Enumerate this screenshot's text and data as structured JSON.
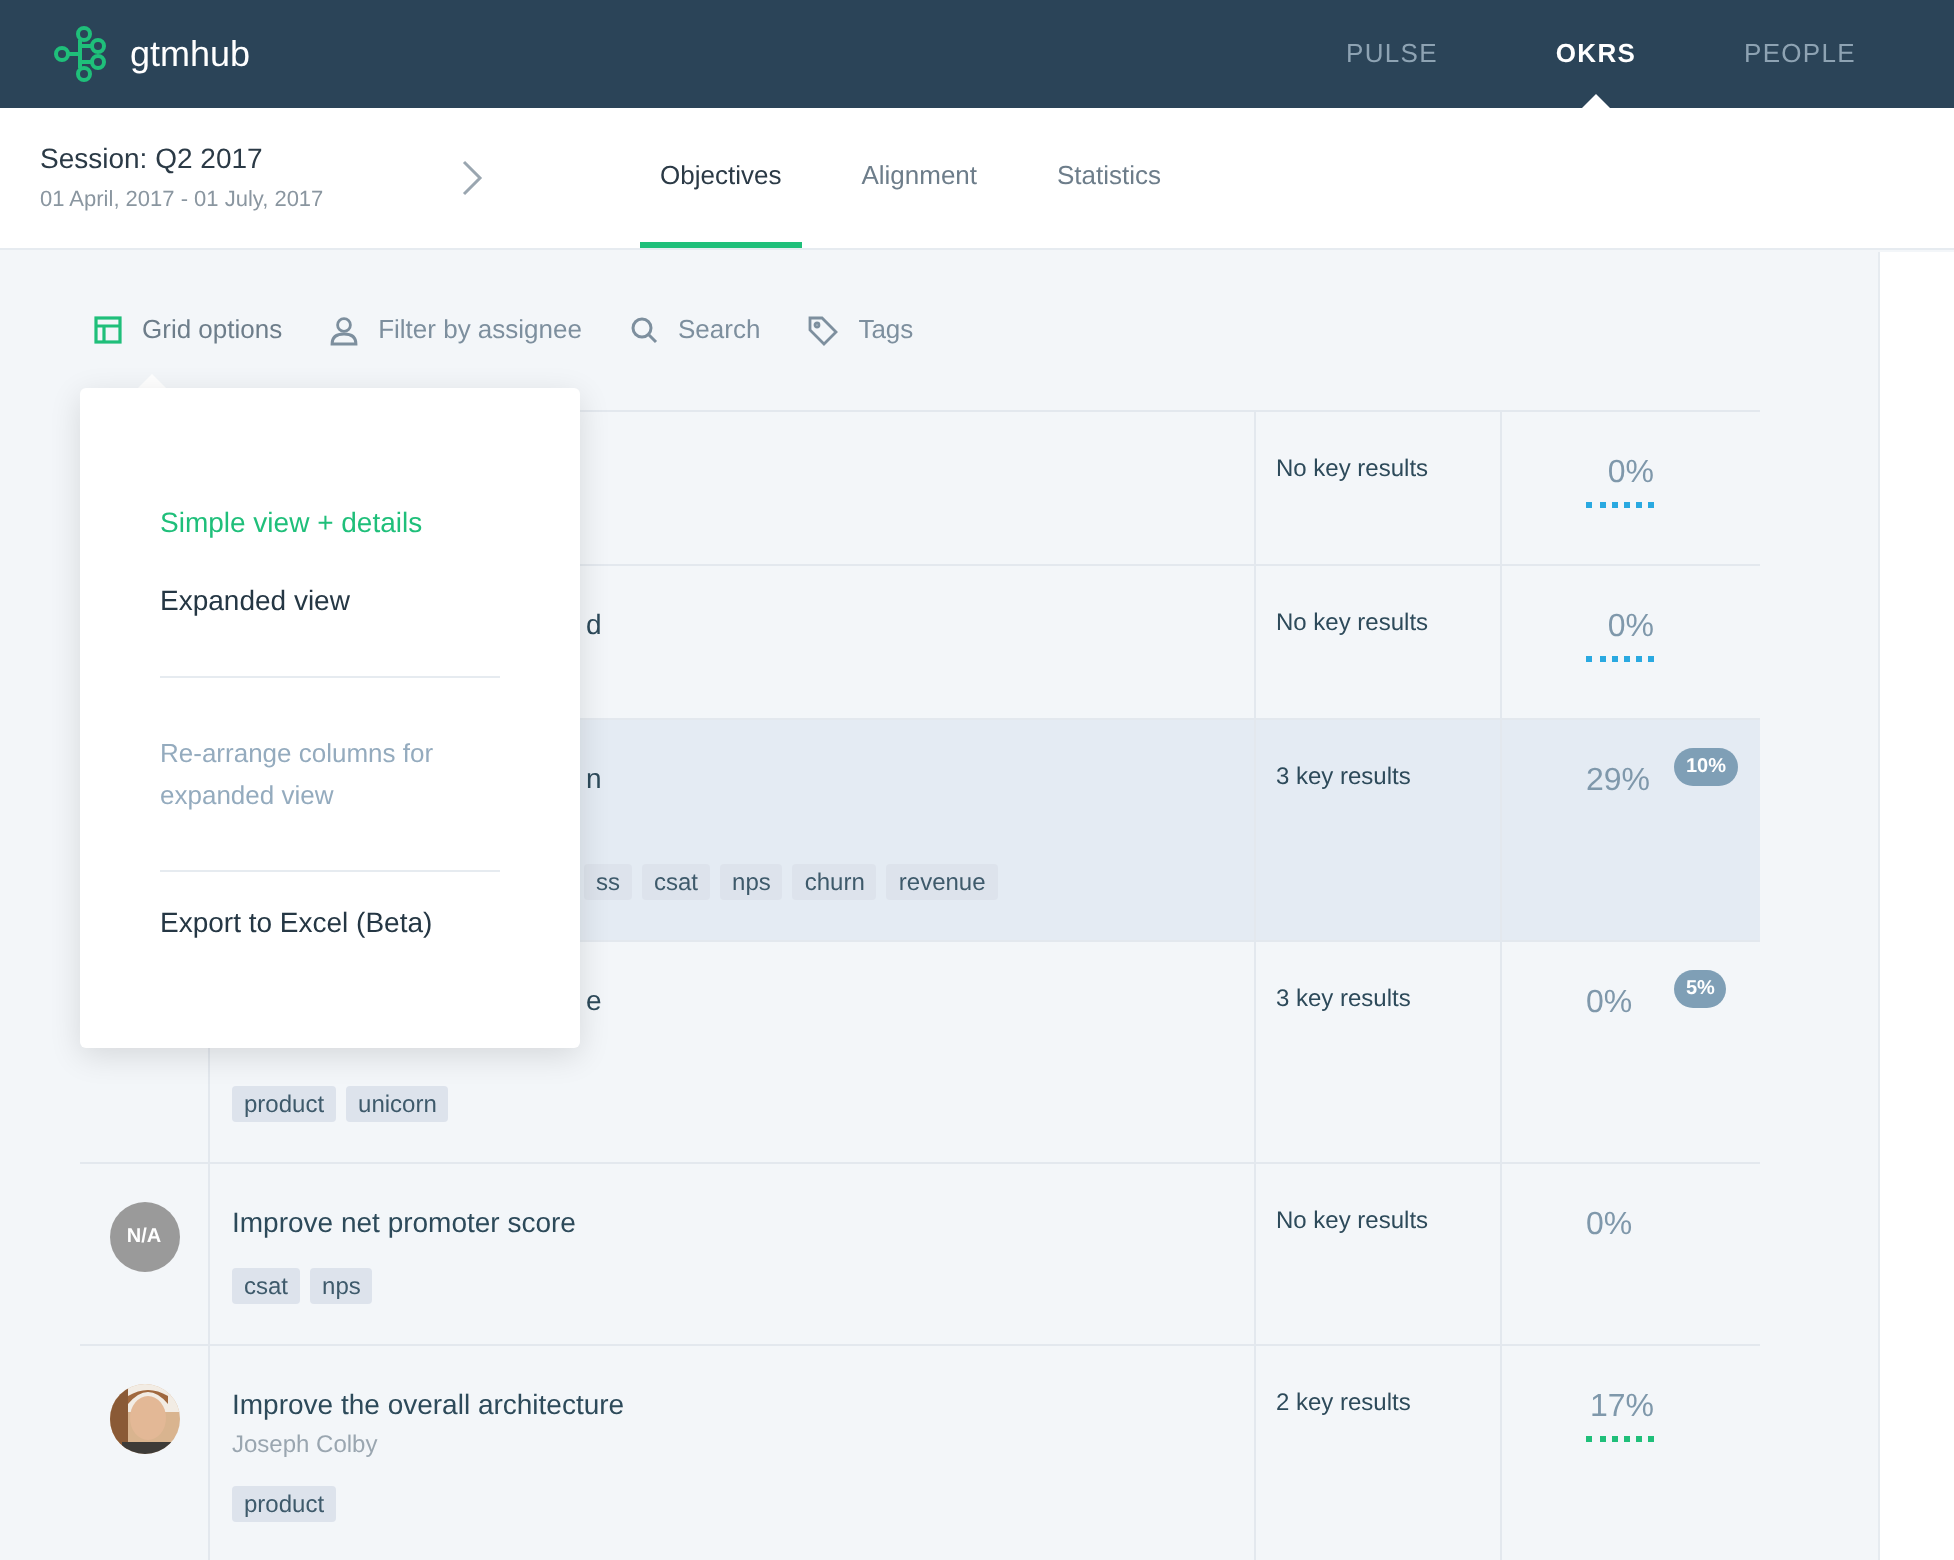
{
  "app": {
    "name": "gtmhub"
  },
  "nav": [
    {
      "label": "PULSE",
      "selected": false
    },
    {
      "label": "OKRS",
      "selected": true
    },
    {
      "label": "PEOPLE",
      "selected": false
    }
  ],
  "session": {
    "title": "Session: Q2 2017",
    "dates": "01 April, 2017 - 01 July, 2017"
  },
  "tabs": [
    {
      "label": "Objectives",
      "selected": true
    },
    {
      "label": "Alignment",
      "selected": false
    },
    {
      "label": "Statistics",
      "selected": false
    }
  ],
  "toolbar": [
    {
      "kind": "grid",
      "label": "Grid options",
      "active": true
    },
    {
      "kind": "person",
      "label": "Filter by assignee",
      "active": false
    },
    {
      "kind": "search",
      "label": "Search",
      "active": false
    },
    {
      "kind": "tag",
      "label": "Tags",
      "active": false
    }
  ],
  "menu": [
    {
      "kind": "option",
      "label": "Simple view + details",
      "selected": true
    },
    {
      "kind": "option",
      "label": "Expanded view",
      "selected": false
    },
    {
      "kind": "divider"
    },
    {
      "kind": "link",
      "label": "Re-arrange columns for expanded view"
    },
    {
      "kind": "divider"
    },
    {
      "kind": "option",
      "label": "Export to Excel (Beta)",
      "selected": false
    }
  ],
  "rows": [
    {
      "tags": [],
      "key_results": "No key results",
      "progress": "0%",
      "color": "#29a9e1",
      "selected": false
    },
    {
      "title": "d",
      "title_covered": true,
      "tags": [],
      "key_results": "No key results",
      "progress": "0%",
      "color": "#29a9e1",
      "selected": false
    },
    {
      "title": "n",
      "title_covered": true,
      "tags": [
        "ss",
        "csat",
        "nps",
        "churn",
        "revenue"
      ],
      "tags_covered": true,
      "key_results": "3 key results",
      "progress": "29%",
      "badge": "10%",
      "selected": true
    },
    {
      "title": "e",
      "title_covered": true,
      "tags": [
        "product",
        "unicorn"
      ],
      "key_results": "3 key results",
      "progress": "0%",
      "badge": "5%",
      "selected": false
    },
    {
      "avatar": {
        "kind": "initials",
        "text": "N/A"
      },
      "title": "Improve net promoter score",
      "tags": [
        "csat",
        "nps"
      ],
      "key_results": "No key results",
      "progress": "0%",
      "selected": false
    },
    {
      "avatar": {
        "kind": "picture"
      },
      "title": "Improve the overall architecture",
      "owner": "Joseph Colby",
      "tags": [
        "product"
      ],
      "key_results": "2 key results",
      "progress": "17%",
      "color": "#1fbf7a",
      "selected": false
    }
  ]
}
